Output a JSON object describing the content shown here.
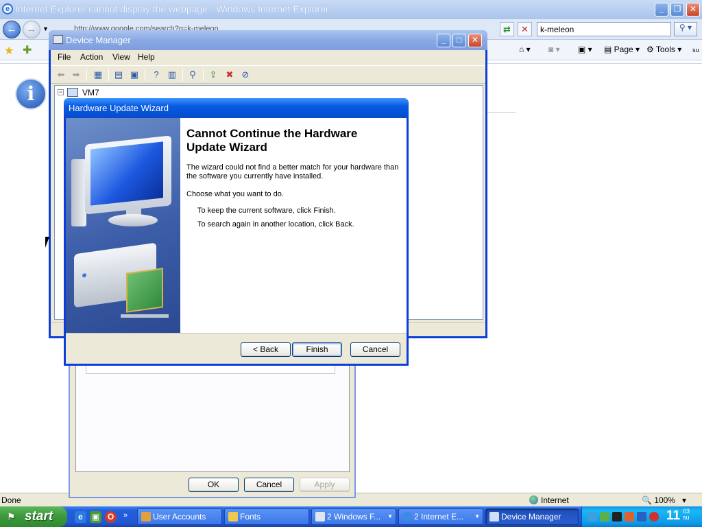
{
  "ie": {
    "title": "Internet Explorer cannot display the webpage - Windows Internet Explorer",
    "address": "http://www.google.com/search?q=k-meleon",
    "search_value": "k-meleon",
    "page_label": "Page",
    "tools_label": "Tools",
    "tab_suffix": "su",
    "status_text": "Done",
    "zone": "Internet",
    "zoom": "100%"
  },
  "device_manager": {
    "title": "Device Manager",
    "menu": [
      "File",
      "Action",
      "View",
      "Help"
    ],
    "tree_root": "VM7"
  },
  "props_dialog": {
    "ok_label": "OK",
    "cancel_label": "Cancel",
    "apply_label": "Apply"
  },
  "wizard": {
    "title": "Hardware Update Wizard",
    "heading": "Cannot Continue the Hardware Update Wizard",
    "message": "The wizard could not find a better match for your hardware than the software you currently have installed.",
    "prompt": "Choose what you want to do.",
    "option1": "To keep the current software, click Finish.",
    "option2": "To search again in another location, click Back.",
    "back_label": "< Back",
    "finish_label": "Finish",
    "cancel_label": "Cancel"
  },
  "taskbar": {
    "start_label": "start",
    "tasks": [
      "User Accounts",
      "Fonts",
      "2 Windows F...",
      "2 Internet E...",
      "Device Manager"
    ],
    "clock": "11",
    "clock_sub": "03",
    "clock_sub2": "su"
  },
  "colors": {
    "xp_blue": "#0a5ae0",
    "taskbar_blue": "#245edb",
    "start_green": "#3c9a3c",
    "dialog_face": "#ece9d8"
  }
}
